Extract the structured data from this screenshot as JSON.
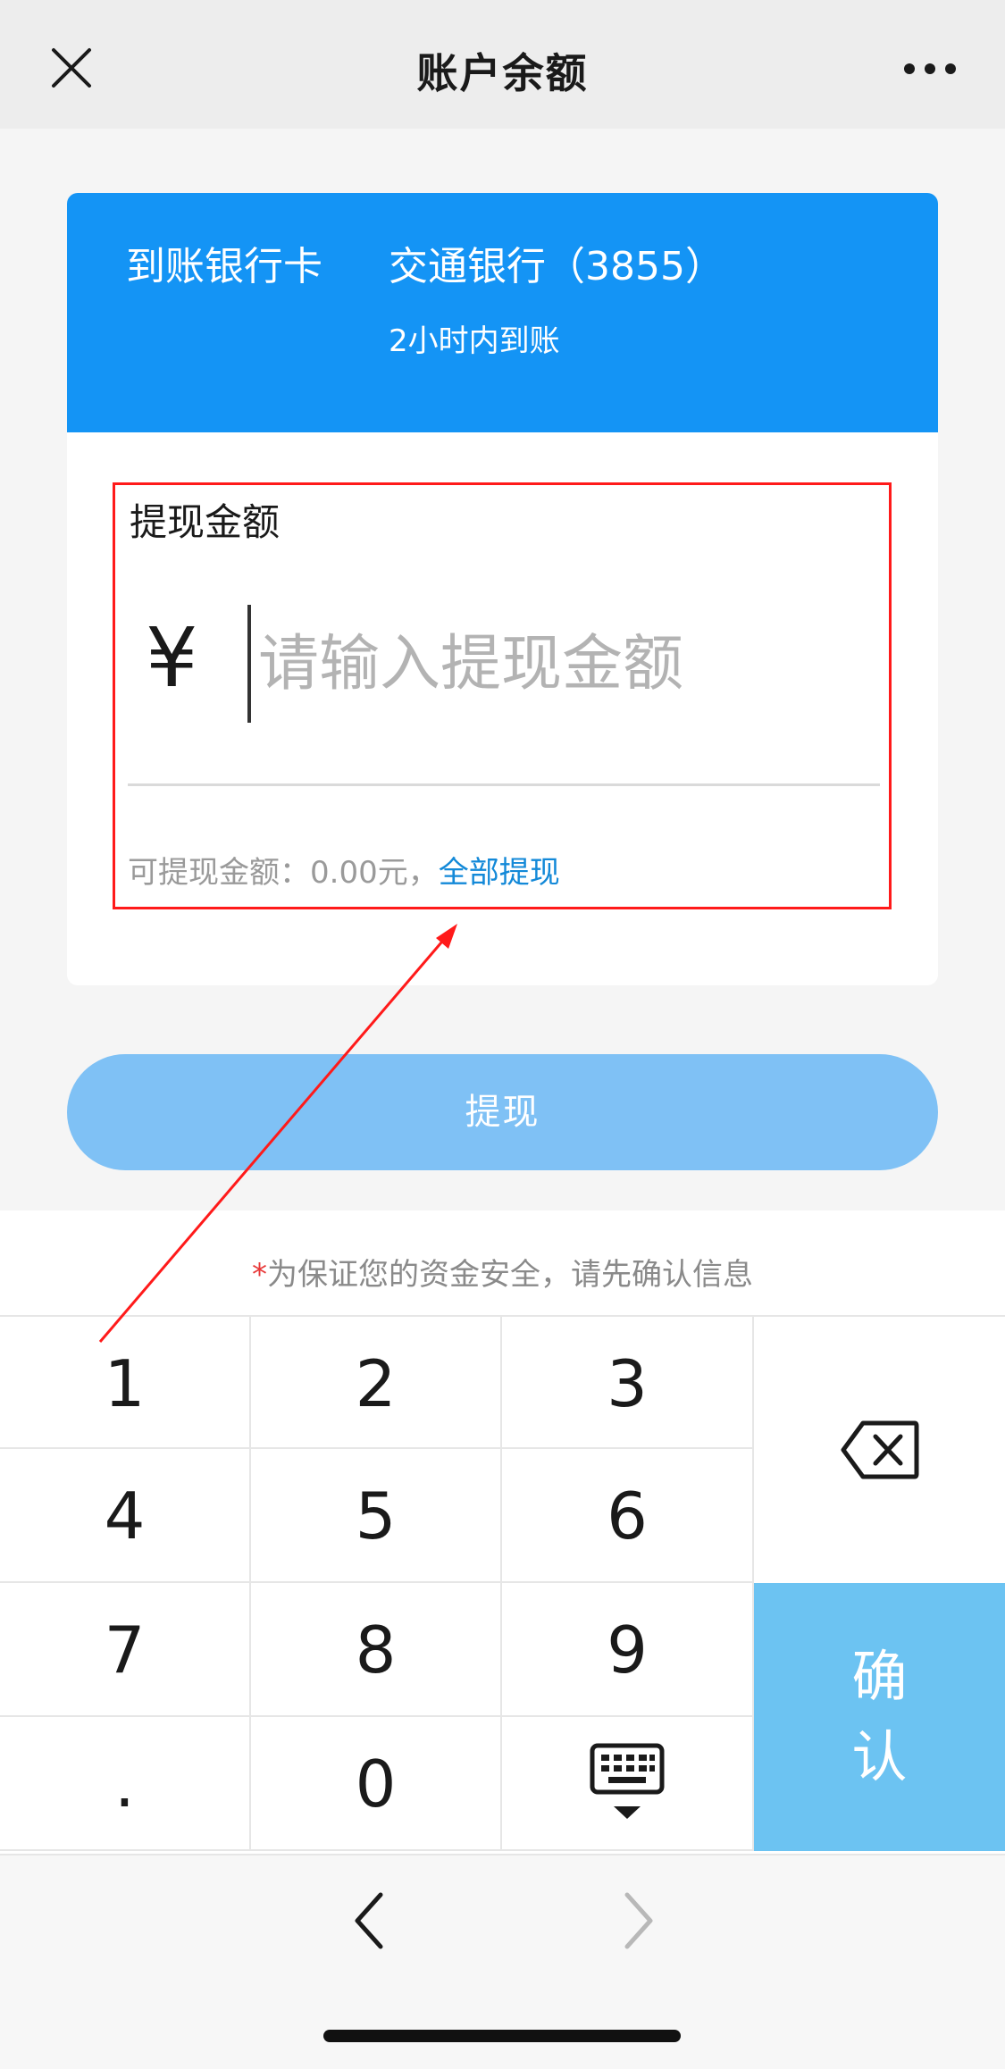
{
  "nav": {
    "title": "账户余额",
    "close_icon": "close-icon",
    "more_icon": "more-icon"
  },
  "bank": {
    "label": "到账银行卡",
    "name": "交通银行（3855）",
    "eta": "2小时内到账"
  },
  "amount": {
    "label": "提现金额",
    "currency_symbol": "¥",
    "placeholder": "请输入提现金额",
    "value": "",
    "available_text": "可提现金额：0.00元，",
    "withdraw_all": "全部提现"
  },
  "submit_label": "提现",
  "notice": {
    "star": "*",
    "text": "为保证您的资金安全，请先确认信息"
  },
  "keypad": {
    "keys": [
      "1",
      "2",
      "3",
      "4",
      "5",
      "6",
      "7",
      "8",
      "9",
      ".",
      "0"
    ],
    "confirm_top": "确",
    "confirm_bottom": "认",
    "delete_icon": "backspace-icon",
    "hide_icon": "keyboard-hide-icon"
  },
  "colors": {
    "header_blue": "#1494f5",
    "button_blue": "#7fc1f5",
    "confirm_blue": "#6cc3f2",
    "link_blue": "#1389d8",
    "annotation_red": "#ff1a1a"
  }
}
